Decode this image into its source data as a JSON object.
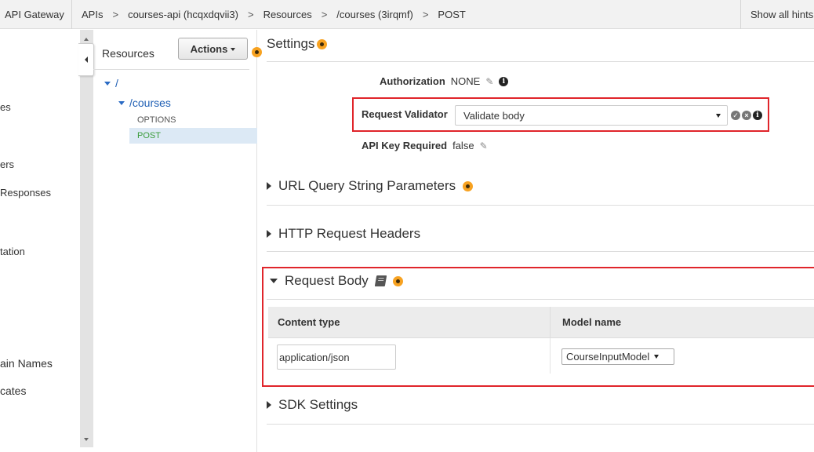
{
  "topbar": {
    "service": "API Gateway",
    "breadcrumb": [
      "APIs",
      "courses-api (hcqxdqvii3)",
      "Resources",
      "/courses (3irqmf)",
      "POST"
    ],
    "separator": ">",
    "hints": "Show all hints"
  },
  "leftnav": {
    "items": [
      "es",
      "ers",
      "Responses",
      "tation",
      "ain Names",
      "cates"
    ]
  },
  "resources": {
    "title": "Resources",
    "actions_label": "Actions",
    "tree": {
      "root": "/",
      "child": "/courses",
      "methods": [
        "OPTIONS",
        "POST"
      ],
      "selected": "POST"
    }
  },
  "settings": {
    "title": "Settings",
    "authorization_label": "Authorization",
    "authorization_value": "NONE",
    "validator_label": "Request Validator",
    "validator_value": "Validate body",
    "api_key_label": "API Key Required",
    "api_key_value": "false"
  },
  "sections": {
    "query": "URL Query String Parameters",
    "headers": "HTTP Request Headers",
    "body": "Request Body",
    "sdk": "SDK Settings"
  },
  "body_table": {
    "col_content_type": "Content type",
    "col_model_name": "Model name",
    "content_type_value": "application/json",
    "model_value": "CourseInputModel"
  },
  "colors": {
    "highlight_border": "#e0252b",
    "beacon": "#f7a221",
    "link": "#1f5fb4",
    "method_selected": "#3a9c3a"
  },
  "icons": [
    "collapse-panel-icon",
    "caret-down-icon",
    "beacon-icon",
    "pencil-icon",
    "info-icon",
    "check-icon",
    "clear-icon",
    "book-icon",
    "triangle-right-icon",
    "triangle-down-icon"
  ]
}
